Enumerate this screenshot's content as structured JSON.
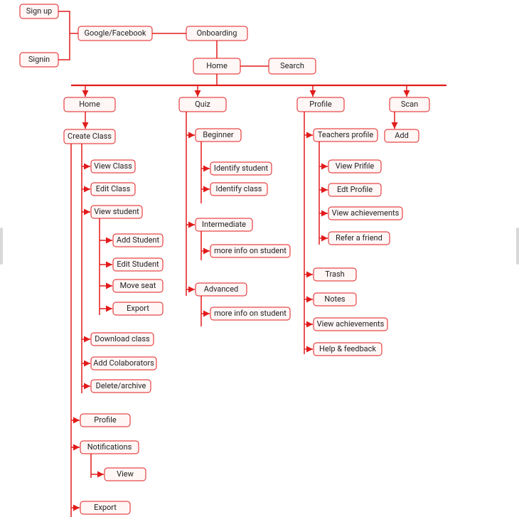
{
  "signup": "Sign up",
  "signin": "Signin",
  "google": "Google/Facebook",
  "onboarding": "Onboarding",
  "homeTop": "Home",
  "search": "Search",
  "col1": {
    "home": "Home",
    "createClass": "Create Class",
    "viewClass": "View Class",
    "editClass": "Edit  Class",
    "viewStudent": "View student",
    "addStudent": "Add Student",
    "editStudent": "Edit Student",
    "moveSeat": "Move seat",
    "exportSub": "Export",
    "downloadClass": "Download class",
    "addCollab": "Add Colaborators",
    "deleteArchive": "Delete/archive",
    "profile": "Profile",
    "notifications": "Notifications",
    "view": "View",
    "export": "Export"
  },
  "col2": {
    "quiz": "Quiz",
    "beginner": "Beginner",
    "identStudent": "Identify student",
    "identClass": "Identify class",
    "intermediate": "Intermediate",
    "more1": "more info on student",
    "advanced": "Advanced",
    "more2": "more info on student"
  },
  "col3": {
    "profile": "Profile",
    "teachers": "Teachers profile",
    "viewProfile": "View Prifile",
    "editProfile": "Edt Profile",
    "viewAch": "View achievements",
    "refer": "Refer a  friend",
    "trash": "Trash",
    "notes": "Notes",
    "viewAch2": "View achievements",
    "help": "Help & feedback"
  },
  "col4": {
    "scan": "Scan",
    "add": "Add"
  }
}
